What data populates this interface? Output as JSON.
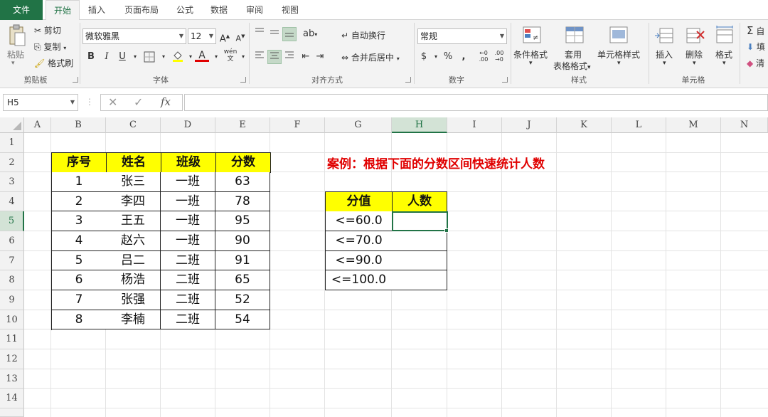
{
  "tabs": [
    "文件",
    "开始",
    "插入",
    "页面布局",
    "公式",
    "数据",
    "审阅",
    "视图"
  ],
  "ribbon": {
    "clipboard": {
      "paste": "粘贴",
      "cut": "剪切",
      "copy": "复制",
      "format_painter": "格式刷",
      "label": "剪贴板"
    },
    "font": {
      "name": "微软雅黑",
      "size": "12",
      "label": "字体"
    },
    "alignment": {
      "wrap": "自动换行",
      "merge": "合并后居中",
      "label": "对齐方式"
    },
    "number": {
      "format": "常规",
      "label": "数字"
    },
    "styles": {
      "conditional": "条件格式",
      "table_line1": "套用",
      "table_line2": "表格格式",
      "cell_styles": "单元格样式",
      "label": "样式"
    },
    "cells": {
      "insert": "插入",
      "delete": "删除",
      "format": "格式",
      "label": "单元格"
    },
    "editing": {
      "autosum": "自",
      "fill": "填",
      "clear": "清"
    }
  },
  "formula_bar": {
    "name_box": "H5",
    "formula": ""
  },
  "columns": [
    "A",
    "B",
    "C",
    "D",
    "E",
    "F",
    "G",
    "H",
    "I",
    "J",
    "K",
    "L",
    "M",
    "N"
  ],
  "rows": [
    "1",
    "2",
    "3",
    "4",
    "5",
    "6",
    "7",
    "8",
    "9",
    "10",
    "11",
    "12",
    "13",
    "14"
  ],
  "selected_cell": "H5",
  "main_table": {
    "headers": [
      "序号",
      "姓名",
      "班级",
      "分数"
    ],
    "rows": [
      [
        "1",
        "张三",
        "一班",
        "63"
      ],
      [
        "2",
        "李四",
        "一班",
        "78"
      ],
      [
        "3",
        "王五",
        "一班",
        "95"
      ],
      [
        "4",
        "赵六",
        "一班",
        "90"
      ],
      [
        "5",
        "吕二",
        "二班",
        "91"
      ],
      [
        "6",
        "杨浩",
        "二班",
        "65"
      ],
      [
        "7",
        "张强",
        "二班",
        "52"
      ],
      [
        "8",
        "李楠",
        "二班",
        "54"
      ]
    ]
  },
  "case_title": "案例：根据下面的分数区间快速统计人数",
  "count_table": {
    "headers": [
      "分值",
      "人数"
    ],
    "rows": [
      [
        "<=60.0",
        ""
      ],
      [
        "<=70.0",
        ""
      ],
      [
        "<=90.0",
        ""
      ],
      [
        "<=100.0",
        ""
      ]
    ]
  },
  "colors": {
    "excel_green": "#217346",
    "header_yellow": "#ffff00",
    "title_red": "#e00000"
  }
}
